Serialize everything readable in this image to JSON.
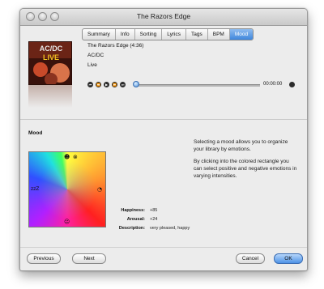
{
  "window": {
    "title": "The Razors Edge"
  },
  "tabs": [
    {
      "label": "Summary",
      "active": false
    },
    {
      "label": "Info",
      "active": false
    },
    {
      "label": "Sorting",
      "active": false
    },
    {
      "label": "Lyrics",
      "active": false
    },
    {
      "label": "Tags",
      "active": false
    },
    {
      "label": "BPM",
      "active": false
    },
    {
      "label": "Mood",
      "active": true
    }
  ],
  "song": {
    "title": "The Razors Edge (4:36)",
    "artist": "AC/DC",
    "album": "Live",
    "art_text": "AC/DC",
    "art_subtext": "LIVE"
  },
  "player": {
    "time": "00:00:00",
    "progress": 0,
    "buttons": [
      "previous-track-icon",
      "rewind-icon",
      "play-icon",
      "fast-forward-icon",
      "next-track-icon"
    ]
  },
  "mood": {
    "section_label": "Mood",
    "info_paragraphs": [
      "Selecting a mood allows you to organize your library by emotions.",
      "By clicking into the colored rectangle you can select positive and negative emotions in varying intensities."
    ],
    "icons": {
      "top": "☻",
      "top_extra": "⊗",
      "left": "zzZ",
      "right": "◔",
      "bottom": "☹"
    },
    "happiness_label": "Happiness:",
    "happiness_value": "+85",
    "arousal_label": "Arousal:",
    "arousal_value": "+24",
    "description_label": "Description:",
    "description_value": "very pleased, happy"
  },
  "buttons": {
    "previous": "Previous",
    "next": "Next",
    "cancel": "Cancel",
    "ok": "OK"
  },
  "colors": {
    "accent": "#3f86dc",
    "window_bg": "#ececec"
  }
}
